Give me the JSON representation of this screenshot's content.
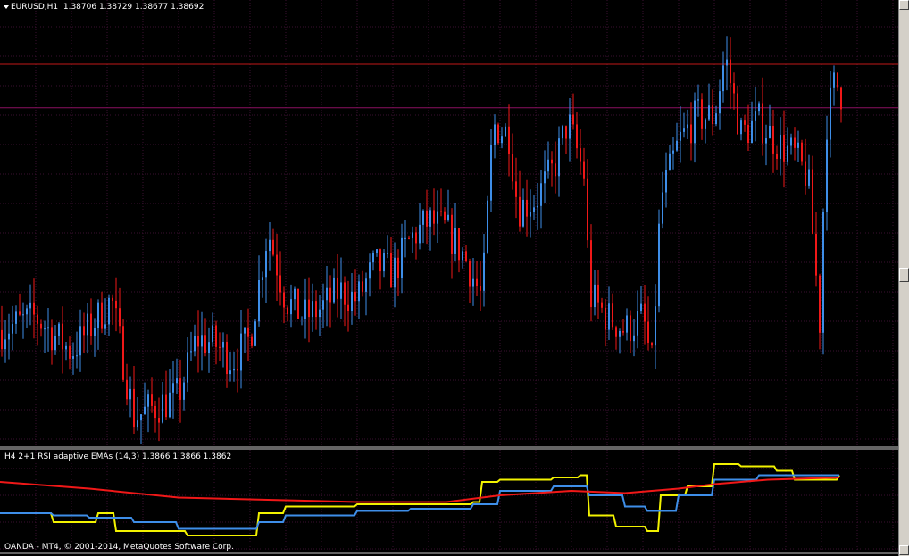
{
  "header": {
    "symbol": "EURUSD,H1",
    "ohlc": "1.38706 1.38729 1.38677 1.38692"
  },
  "indicator": {
    "title": "H4 2+1 RSI adaptive EMAs (14,3) 1.3866 1.3866 1.3862"
  },
  "footer": {
    "copyright": "OANDA - MT4, © 2001-2014, MetaQuotes Software Corp."
  },
  "colors": {
    "background": "#000000",
    "grid": "#3a1030",
    "bull": "#3e8ee8",
    "bear": "#f01818",
    "level": "#c01818",
    "level2": "#8a1060",
    "yellow": "#f2f200",
    "blue": "#3e8ee8",
    "red": "#f01818",
    "separator": "#c8c8c8"
  },
  "chart_data": [
    {
      "type": "line",
      "title": "EURUSD,H1",
      "candle_style": "candlestick",
      "price_levels": [
        1.3876,
        1.3866
      ],
      "approx_close_path": [
        [
          0,
          1.3815
        ],
        [
          40,
          1.3818
        ],
        [
          80,
          1.381
        ],
        [
          110,
          1.3818
        ],
        [
          125,
          1.3822
        ],
        [
          150,
          1.3795
        ],
        [
          180,
          1.3798
        ],
        [
          200,
          1.38
        ],
        [
          220,
          1.3813
        ],
        [
          240,
          1.3812
        ],
        [
          260,
          1.3808
        ],
        [
          280,
          1.3813
        ],
        [
          300,
          1.3838
        ],
        [
          320,
          1.3822
        ],
        [
          340,
          1.3818
        ],
        [
          360,
          1.382
        ],
        [
          380,
          1.3824
        ],
        [
          400,
          1.3822
        ],
        [
          420,
          1.383
        ],
        [
          440,
          1.3828
        ],
        [
          460,
          1.3836
        ],
        [
          480,
          1.384
        ],
        [
          500,
          1.3838
        ],
        [
          520,
          1.3832
        ],
        [
          540,
          1.3822
        ],
        [
          552,
          1.3862
        ],
        [
          570,
          1.386
        ],
        [
          580,
          1.3843
        ],
        [
          600,
          1.3845
        ],
        [
          620,
          1.3852
        ],
        [
          636,
          1.3863
        ],
        [
          655,
          1.385
        ],
        [
          660,
          1.3823
        ],
        [
          680,
          1.3818
        ],
        [
          700,
          1.3815
        ],
        [
          720,
          1.3818
        ],
        [
          730,
          1.3807
        ],
        [
          740,
          1.3845
        ],
        [
          760,
          1.3858
        ],
        [
          780,
          1.3864
        ],
        [
          800,
          1.3864
        ],
        [
          812,
          1.3878
        ],
        [
          830,
          1.386
        ],
        [
          850,
          1.3863
        ],
        [
          870,
          1.3858
        ],
        [
          890,
          1.3855
        ],
        [
          905,
          1.385
        ],
        [
          918,
          1.3817
        ],
        [
          925,
          1.3862
        ],
        [
          935,
          1.3872
        ],
        [
          943,
          1.3869
        ]
      ]
    },
    {
      "type": "line",
      "title": "H4 2+1 RSI adaptive EMAs (14,3)",
      "current_values": [
        1.3866,
        1.3866,
        1.3862
      ],
      "series": [
        {
          "color": "#f2f200",
          "points": [
            [
              0,
              1.3826
            ],
            [
              40,
              1.3826
            ],
            [
              60,
              1.3822
            ],
            [
              90,
              1.3822
            ],
            [
              110,
              1.3826
            ],
            [
              130,
              1.3818
            ],
            [
              180,
              1.3818
            ],
            [
              210,
              1.3816
            ],
            [
              250,
              1.3816
            ],
            [
              290,
              1.3826
            ],
            [
              320,
              1.3829
            ],
            [
              400,
              1.383
            ],
            [
              460,
              1.383
            ],
            [
              530,
              1.3831
            ],
            [
              540,
              1.384
            ],
            [
              560,
              1.3841
            ],
            [
              620,
              1.3842
            ],
            [
              650,
              1.3843
            ],
            [
              660,
              1.3825
            ],
            [
              690,
              1.382
            ],
            [
              725,
              1.3818
            ],
            [
              740,
              1.3834
            ],
            [
              770,
              1.3838
            ],
            [
              800,
              1.3848
            ],
            [
              830,
              1.3847
            ],
            [
              870,
              1.3845
            ],
            [
              890,
              1.3841
            ],
            [
              940,
              1.3843
            ]
          ]
        },
        {
          "color": "#3e8ee8",
          "points": [
            [
              0,
              1.3826
            ],
            [
              60,
              1.3825
            ],
            [
              100,
              1.3824
            ],
            [
              150,
              1.3822
            ],
            [
              200,
              1.3819
            ],
            [
              250,
              1.3819
            ],
            [
              290,
              1.3822
            ],
            [
              320,
              1.3825
            ],
            [
              400,
              1.3827
            ],
            [
              460,
              1.3828
            ],
            [
              530,
              1.383
            ],
            [
              560,
              1.3836
            ],
            [
              620,
              1.3838
            ],
            [
              660,
              1.3834
            ],
            [
              700,
              1.3829
            ],
            [
              725,
              1.3827
            ],
            [
              760,
              1.3834
            ],
            [
              800,
              1.3841
            ],
            [
              850,
              1.3843
            ],
            [
              900,
              1.3843
            ],
            [
              940,
              1.3843
            ]
          ]
        },
        {
          "color": "#f01818",
          "points": [
            [
              0,
              1.384
            ],
            [
              100,
              1.3837
            ],
            [
              200,
              1.3833
            ],
            [
              300,
              1.3832
            ],
            [
              400,
              1.3831
            ],
            [
              500,
              1.3831
            ],
            [
              560,
              1.3834
            ],
            [
              640,
              1.3836
            ],
            [
              700,
              1.3835
            ],
            [
              760,
              1.3837
            ],
            [
              800,
              1.3839
            ],
            [
              860,
              1.3841
            ],
            [
              940,
              1.3842
            ]
          ]
        }
      ]
    }
  ]
}
